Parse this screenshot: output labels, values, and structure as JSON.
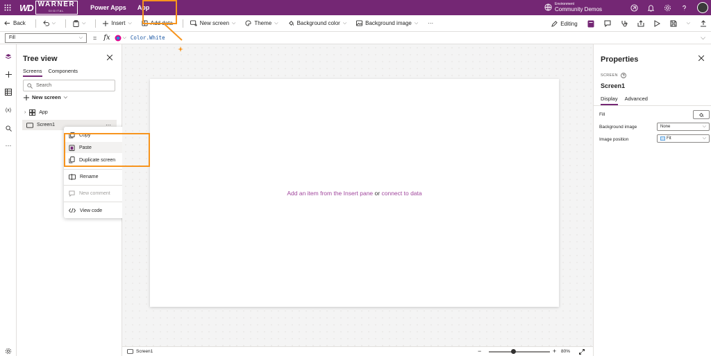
{
  "topbar": {
    "logo_wd": "WD",
    "logo_brand": "WARNER",
    "logo_sub": "DIGITAL",
    "product": "Power Apps",
    "app": "App",
    "env_label": "Environment",
    "env_name": "Community Demos"
  },
  "commandbar": {
    "back": "Back",
    "insert": "Insert",
    "add_data": "Add data",
    "new_screen": "New screen",
    "theme": "Theme",
    "background_color": "Background color",
    "background_image": "Background image",
    "more": "···",
    "editing": "Editing"
  },
  "formula": {
    "property": "Fill",
    "fx": "fx",
    "expression": "Color.White"
  },
  "tree": {
    "title": "Tree view",
    "tabs": [
      "Screens",
      "Components"
    ],
    "search_placeholder": "Search",
    "new_screen": "New screen",
    "items": [
      {
        "label": "App"
      },
      {
        "label": "Screen1",
        "more": "···"
      }
    ]
  },
  "context_menu": {
    "items": [
      "Copy",
      "Paste",
      "Duplicate screen",
      "Rename",
      "New comment",
      "View code"
    ]
  },
  "canvas": {
    "hint_link1": "Add an item from the Insert pane",
    "hint_or": "or",
    "hint_link2": "connect to data"
  },
  "status": {
    "screen": "Screen1",
    "zoom": "80%",
    "zoom_level": 0.4
  },
  "properties": {
    "title": "Properties",
    "type_label": "SCREEN",
    "screen_name": "Screen1",
    "tabs": [
      "Display",
      "Advanced"
    ],
    "fill_label": "Fill",
    "bg_image_label": "Background image",
    "bg_image_value": "None",
    "img_pos_label": "Image position",
    "img_pos_value": "Fit"
  },
  "colors": {
    "brand": "#742774",
    "highlight": "#f7941d",
    "link": "#a1479d"
  }
}
